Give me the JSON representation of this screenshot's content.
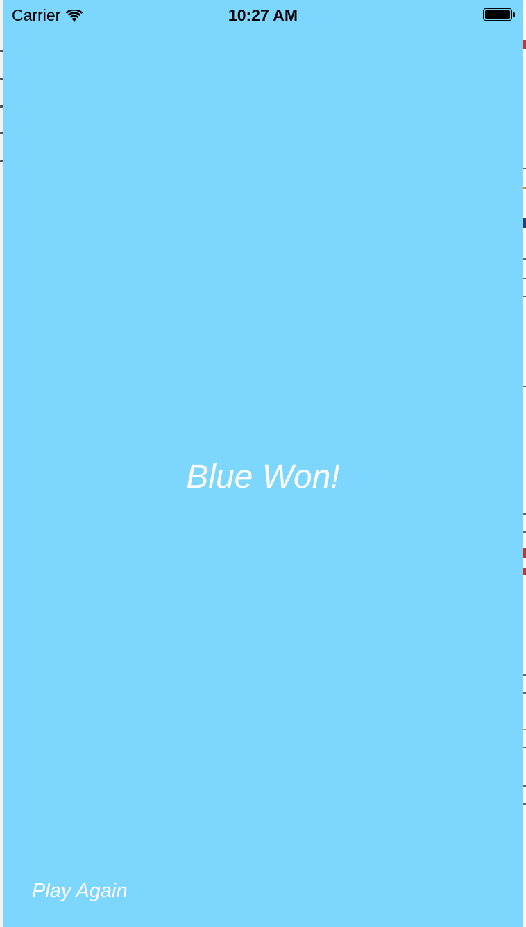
{
  "status_bar": {
    "carrier": "Carrier",
    "time": "10:27 AM",
    "wifi_icon": "wifi-icon",
    "battery_icon": "battery-icon"
  },
  "game": {
    "result": "Blue Won!",
    "play_again_label": "Play Again",
    "background_color": "#7dd6fe",
    "text_color": "#ffffff"
  }
}
